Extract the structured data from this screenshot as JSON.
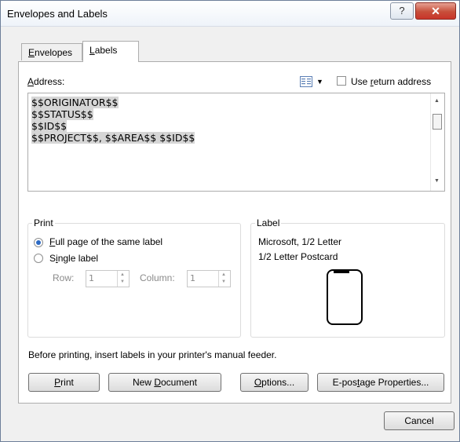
{
  "window": {
    "title": "Envelopes and Labels",
    "help_label": "?",
    "close_label": "✕"
  },
  "tabs": [
    {
      "label_pre": "",
      "accel": "E",
      "label_post": "nvelopes",
      "selected": false
    },
    {
      "label_pre": "",
      "accel": "L",
      "label_post": "abels",
      "selected": true
    }
  ],
  "address": {
    "label_pre": "",
    "accel": "A",
    "label_post": "ddress:",
    "lines": [
      "$$ORIGINATOR$$",
      "$$STATUS$$",
      "$$ID$$",
      "$$PROJECT$$, $$AREA$$  $$ID$$"
    ],
    "use_return": {
      "label_pre": "Use ",
      "accel": "r",
      "label_post": "eturn address",
      "checked": false
    }
  },
  "print_group": {
    "legend": "Print",
    "full_page": {
      "accel": "F",
      "label_post": "ull page of the same label",
      "selected": true
    },
    "single": {
      "label_pre": "S",
      "accel": "i",
      "label_post": "ngle label",
      "selected": false
    },
    "row_label": "Row:",
    "row_value": "1",
    "column_label": "Column:",
    "column_value": "1"
  },
  "label_group": {
    "legend": "Label",
    "vendor": "Microsoft, 1/2 Letter",
    "product": "1/2 Letter Postcard"
  },
  "note": "Before printing, insert labels in your printer's manual feeder.",
  "buttons": {
    "print": {
      "label_pre": "",
      "accel": "P",
      "label_post": "rint"
    },
    "new_document": {
      "label_pre": "New ",
      "accel": "D",
      "label_post": "ocument"
    },
    "options": {
      "label_pre": "",
      "accel": "O",
      "label_post": "ptions..."
    },
    "epostage": {
      "label_pre": "E-pos",
      "accel": "t",
      "label_post": "age Properties..."
    },
    "cancel": "Cancel"
  },
  "colors": {
    "close_button": "#c9352a",
    "radio_selected": "#2d6ac4",
    "dialog_bg": "#f0f0f0"
  }
}
